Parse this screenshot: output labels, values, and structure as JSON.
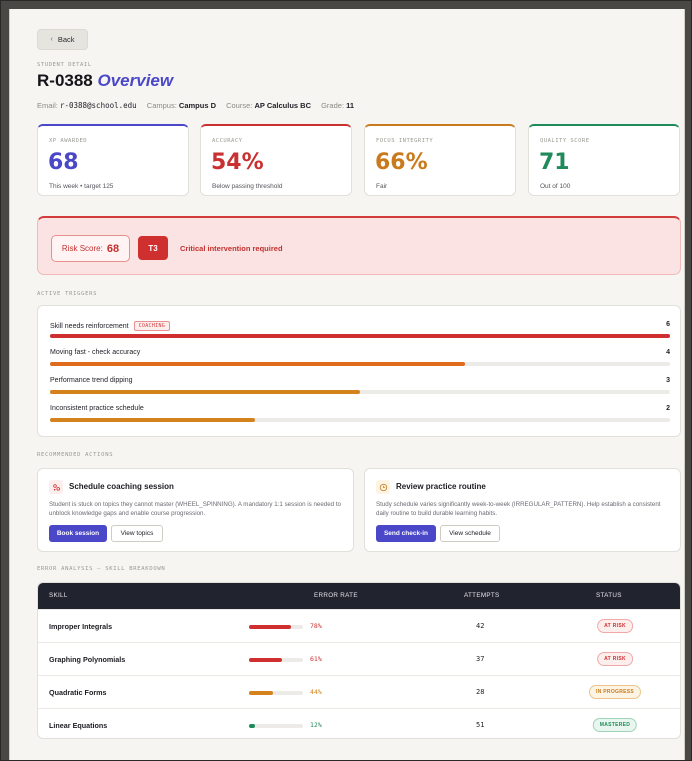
{
  "back_label": "Back",
  "eyebrow": "STUDENT DETAIL",
  "title_id": "R-0388",
  "title_suffix": "Overview",
  "meta": {
    "email_label": "Email:",
    "email": "r-0388@school.edu",
    "campus_label": "Campus:",
    "campus": "Campus D",
    "course_label": "Course:",
    "course": "AP Calculus BC",
    "grade_label": "Grade:",
    "grade": "11"
  },
  "stats": [
    {
      "label": "XP AWARDED",
      "value": "68",
      "sub": "This week • target 125",
      "color": "#4a48c8"
    },
    {
      "label": "ACCURACY",
      "value": "54%",
      "sub": "Below passing threshold",
      "color": "#c93030"
    },
    {
      "label": "FOCUS INTEGRITY",
      "value": "66%",
      "sub": "Fair",
      "color": "#c97a1c"
    },
    {
      "label": "QUALITY SCORE",
      "value": "71",
      "sub": "Out of 100",
      "color": "#1f8a5a"
    }
  ],
  "risk": {
    "score_label": "Risk Score:",
    "score": "68",
    "tier": "T3",
    "message": "Critical intervention required"
  },
  "triggers_label": "ACTIVE TRIGGERS",
  "triggers": [
    {
      "name": "Skill needs reinforcement",
      "tag": "COACHING",
      "count": "6",
      "fraction": 1.0,
      "color": "#d02f2f"
    },
    {
      "name": "Moving fast - check accuracy",
      "tag": "",
      "count": "4",
      "fraction": 0.67,
      "color": "#e06b1e"
    },
    {
      "name": "Performance trend dipping",
      "tag": "",
      "count": "3",
      "fraction": 0.5,
      "color": "#d4821c"
    },
    {
      "name": "Inconsistent practice schedule",
      "tag": "",
      "count": "2",
      "fraction": 0.33,
      "color": "#d4821c"
    }
  ],
  "actions_label": "RECOMMENDED ACTIONS",
  "actions": [
    {
      "title": "Schedule coaching session",
      "icon": "people-icon",
      "desc": "Student is stuck on topics they cannot master (WHEEL_SPINNING). A mandatory 1:1 session is needed to unblock knowledge gaps and enable course progression.",
      "primary": "Book session",
      "secondary": "View topics"
    },
    {
      "title": "Review practice routine",
      "icon": "clock-icon",
      "desc": "Study schedule varies significantly week-to-week (IRREGULAR_PATTERN). Help establish a consistent daily routine to build durable learning habits.",
      "primary": "Send check-in",
      "secondary": "View schedule"
    }
  ],
  "errors_label": "ERROR ANALYSIS — SKILL BREAKDOWN",
  "table": {
    "headers": [
      "SKILL",
      "ERROR RATE",
      "ATTEMPTS",
      "STATUS"
    ],
    "rows": [
      {
        "skill": "Improper Integrals",
        "rate": "78%",
        "fraction": 0.78,
        "attempts": "42",
        "status": "AT RISK",
        "color": "#d02f2f",
        "status_color": "#d02f2f",
        "status_bg": "#fdeeee",
        "status_border": "#f0a8a8"
      },
      {
        "skill": "Graphing Polynomials",
        "rate": "61%",
        "fraction": 0.61,
        "attempts": "37",
        "status": "AT RISK",
        "color": "#d02f2f",
        "status_color": "#d02f2f",
        "status_bg": "#fdeeee",
        "status_border": "#f0a8a8"
      },
      {
        "skill": "Quadratic Forms",
        "rate": "44%",
        "fraction": 0.44,
        "attempts": "28",
        "status": "IN PROGRESS",
        "color": "#d4821c",
        "status_color": "#c97a1c",
        "status_bg": "#fdf4e3",
        "status_border": "#ecc48a"
      },
      {
        "skill": "Linear Equations",
        "rate": "12%",
        "fraction": 0.12,
        "attempts": "51",
        "status": "MASTERED",
        "color": "#1f8a5a",
        "status_color": "#1f8a5a",
        "status_bg": "#e9f6ef",
        "status_border": "#9fd4b8"
      }
    ]
  }
}
